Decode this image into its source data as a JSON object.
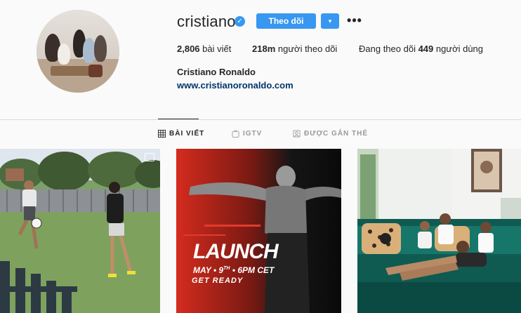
{
  "profile": {
    "username": "cristiano",
    "follow_label": "Theo dõi",
    "dropdown_icon": "▾",
    "more_icon": "•••",
    "verified_icon": "✓",
    "posts_count": "2,806",
    "posts_label": "bài viết",
    "followers_count": "218m",
    "followers_label": "người theo dõi",
    "following_prefix": "Đang theo dõi",
    "following_count": "449",
    "following_suffix": "người dùng",
    "full_name": "Cristiano Ronaldo",
    "website": "www.cristianoronaldo.com"
  },
  "tabs": [
    {
      "label": "BÀI VIẾT",
      "icon": "grid-icon",
      "active": true
    },
    {
      "label": "IGTV",
      "icon": "igtv-icon",
      "active": false
    },
    {
      "label": "ĐƯỢC GẮN THẺ",
      "icon": "tagged-icon",
      "active": false
    }
  ],
  "posts": {
    "launch_title": "LAUNCH",
    "launch_date_a": "MAY • 9",
    "launch_date_sup": "TH",
    "launch_date_b": " • 6PM CET",
    "launch_ready": "GET READY"
  },
  "colors": {
    "accent": "#3897f0",
    "link": "#003569",
    "background": "#fafafa",
    "divider": "#dbdbdb"
  }
}
